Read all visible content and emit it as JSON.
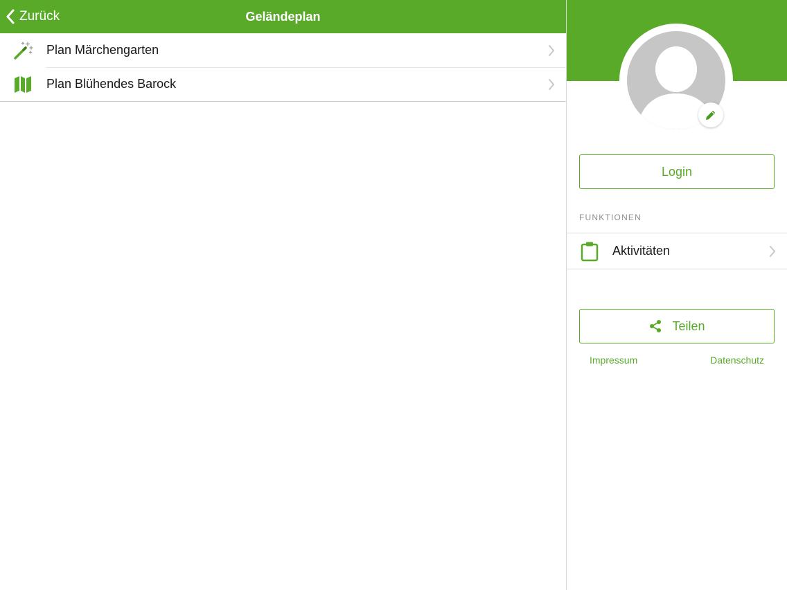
{
  "navbar": {
    "back_label": "Zurück",
    "title": "Geländeplan"
  },
  "list": {
    "items": [
      {
        "label": "Plan Märchengarten",
        "icon": "magic-wand-icon"
      },
      {
        "label": "Plan Blühendes Barock",
        "icon": "map-icon"
      }
    ]
  },
  "profile": {
    "avatar_icon": "user-avatar-icon",
    "edit_icon": "pencil-icon"
  },
  "sidebar": {
    "login_label": "Login",
    "section_label": "FUNKTIONEN",
    "functions": [
      {
        "label": "Aktivitäten",
        "icon": "clipboard-icon"
      }
    ],
    "share_label": "Teilen",
    "share_icon": "share-icon",
    "impressum_label": "Impressum",
    "datenschutz_label": "Datenschutz"
  },
  "colors": {
    "brand_green": "#5aaa2a",
    "avatar_gray": "#c6c6c7",
    "chevron_gray": "#c7c7cc"
  }
}
